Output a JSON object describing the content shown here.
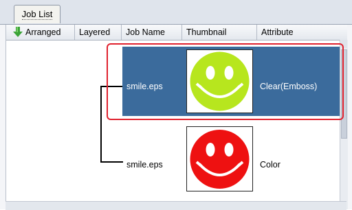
{
  "tabs": [
    {
      "label": "Job List"
    }
  ],
  "columns": {
    "arranged": "Arranged",
    "layered": "Layered",
    "job_name": "Job Name",
    "thumbnail": "Thumbnail",
    "attribute": "Attribute"
  },
  "icons": {
    "sort": "green-down-arrow-icon"
  },
  "rows": [
    {
      "job_name": "smile.eps",
      "thumbnail": "yellow-green-smiley",
      "attribute": "Clear(Emboss)",
      "selected": true
    },
    {
      "job_name": "smile.eps",
      "thumbnail": "red-smiley",
      "attribute": "Color",
      "selected": false
    }
  ],
  "colors": {
    "selection": "#3b6b9c",
    "highlight_outline": "#e0202d",
    "smiley_1": "#b7e61e",
    "smiley_2": "#ee1111"
  }
}
